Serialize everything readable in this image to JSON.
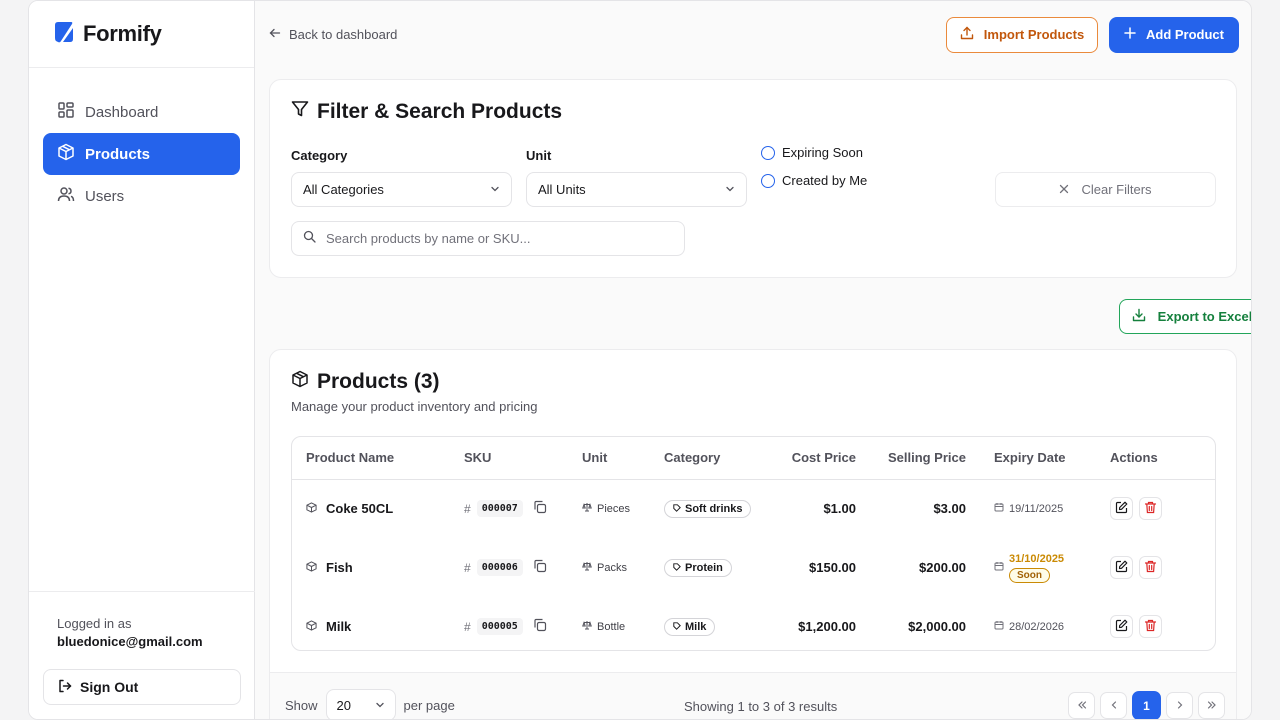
{
  "brand": {
    "name": "Formify",
    "logo_icon": "leaf-logo-icon"
  },
  "sidebar": {
    "items": [
      {
        "label": "Dashboard",
        "icon": "grid-icon",
        "active": false
      },
      {
        "label": "Products",
        "icon": "package-icon",
        "active": true
      },
      {
        "label": "Users",
        "icon": "users-icon",
        "active": false
      }
    ],
    "logged_in_label": "Logged in as",
    "logged_in_email": "bluedonice@gmail.com",
    "sign_out_label": "Sign Out"
  },
  "topbar": {
    "back_label": "Back to dashboard",
    "import_label": "Import Products",
    "add_label": "Add Product"
  },
  "filter": {
    "title": "Filter & Search Products",
    "category_label": "Category",
    "category_value": "All Categories",
    "unit_label": "Unit",
    "unit_value": "All Units",
    "radio_expiring": "Expiring Soon",
    "radio_created": "Created by Me",
    "clear_label": "Clear Filters",
    "search_placeholder": "Search products by name or SKU..."
  },
  "export_label": "Export to Excel",
  "products": {
    "title": "Products (3)",
    "subtitle": "Manage your product inventory and pricing",
    "columns": [
      "Product Name",
      "SKU",
      "Unit",
      "Category",
      "Cost Price",
      "Selling Price",
      "Expiry Date",
      "Actions"
    ],
    "rows": [
      {
        "name": "Coke 50CL",
        "sku": "000007",
        "unit": "Pieces",
        "category": "Soft drinks",
        "cost": "$1.00",
        "selling": "$3.00",
        "expiry": "19/11/2025",
        "soon": ""
      },
      {
        "name": "Fish",
        "sku": "000006",
        "unit": "Packs",
        "category": "Protein",
        "cost": "$150.00",
        "selling": "$200.00",
        "expiry": "31/10/2025",
        "soon": "Soon"
      },
      {
        "name": "Milk",
        "sku": "000005",
        "unit": "Bottle",
        "category": "Milk",
        "cost": "$1,200.00",
        "selling": "$2,000.00",
        "expiry": "28/02/2026",
        "soon": ""
      }
    ]
  },
  "pagination": {
    "show_label": "Show",
    "per_page_value": "20",
    "per_page_label": "per page",
    "results_text": "Showing 1 to 3 of 3 results",
    "current_page": "1"
  },
  "colors": {
    "accent": "#2563eb",
    "import": "#ea8a3c",
    "export": "#22a55a",
    "danger": "#dc2626",
    "soon": "#ca8a04"
  }
}
